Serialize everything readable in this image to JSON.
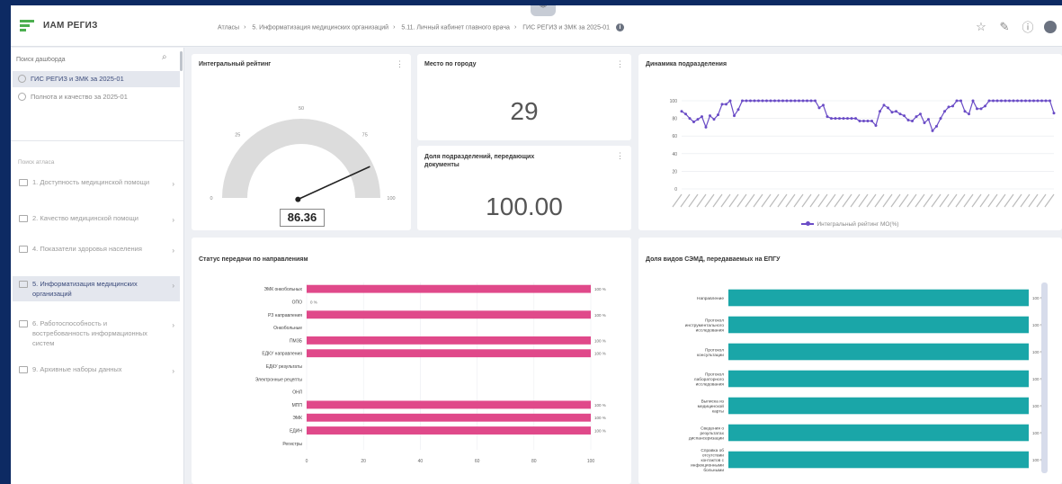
{
  "header": {
    "app_title": "ИАМ РЕГИЗ",
    "breadcrumb": [
      "Атласы",
      "5. Информатизация медицинских организаций",
      "5.11. Личный кабинет главного врача",
      "ГИС РЕГИЗ и ЗМК за 2025-01"
    ],
    "info": "i"
  },
  "sidebar": {
    "search_placeholder": "Поиск дашборда",
    "dashboards": [
      {
        "label": "ГИС РЕГИЗ и ЗМК за 2025-01",
        "active": true
      },
      {
        "label": "Полнота и качество за 2025-01",
        "active": false
      }
    ],
    "atlas_title": "Поиск атласа",
    "atlases": [
      {
        "label": "1. Доступность медицинской помощи",
        "active": false
      },
      {
        "label": "2. Качество медицинской помощи",
        "active": false
      },
      {
        "label": "4. Показатели здоровья населения",
        "active": false
      },
      {
        "label": "5. Информатизация медицинских организаций",
        "active": true
      },
      {
        "label": "6. Работоспособность и востребованность информационных систем",
        "active": false
      },
      {
        "label": "9. Архивные наборы данных",
        "active": false
      }
    ]
  },
  "cards": {
    "gauge": {
      "title": "Интегральный рейтинг",
      "value": "86.36"
    },
    "place": {
      "title": "Место по городу",
      "value": "29"
    },
    "share": {
      "title": "Доля подразделений, передающих документы",
      "value": "100.00"
    },
    "dynamics": {
      "title": "Динамика подразделения",
      "legend": "Интегральный рейтинг МО(%)"
    },
    "status": {
      "title": "Статус передачи по направлениям"
    },
    "semd": {
      "title": "Доля видов СЭМД, передаваемых на ЕПГУ"
    }
  },
  "colors": {
    "pink": "#e0498a",
    "teal": "#1aa6a8",
    "purple": "#6a4cc6",
    "accent_nav": "#3a4a7a"
  },
  "chart_data": [
    {
      "type": "gauge",
      "min": 0,
      "max": 100,
      "ticks": [
        0,
        25,
        50,
        75,
        100
      ],
      "value": 86.36
    },
    {
      "type": "line",
      "title": "Динамика подразделения",
      "ylim": [
        0,
        100
      ],
      "yticks": [
        0,
        20,
        40,
        60,
        80,
        100
      ],
      "series": [
        {
          "name": "Интегральный рейтинг МО(%)",
          "values": [
            88,
            85,
            80,
            76,
            79,
            82,
            70,
            83,
            79,
            84,
            96,
            96,
            100,
            83,
            90,
            100,
            100,
            100,
            100,
            100,
            100,
            100,
            100,
            100,
            100,
            100,
            100,
            100,
            100,
            100,
            100,
            100,
            100,
            100,
            92,
            95,
            82,
            80,
            80,
            80,
            80,
            80,
            80,
            80,
            77,
            77,
            77,
            77,
            72,
            88,
            95,
            92,
            87,
            88,
            85,
            83,
            78,
            77,
            82,
            85,
            75,
            79,
            66,
            71,
            80,
            88,
            93,
            94,
            100,
            100,
            88,
            85,
            100,
            91,
            91,
            94,
            100,
            100,
            100,
            100,
            100,
            100,
            100,
            100,
            100,
            100,
            100,
            100,
            100,
            100,
            100,
            100,
            86
          ]
        }
      ],
      "grid": true
    },
    {
      "type": "bar",
      "orientation": "horizontal",
      "title": "Статус передачи по направлениям",
      "categories": [
        "ЭМК онкобольных",
        "ОПО",
        "РЗ направления",
        "Онкобольные",
        "ПМЗБ",
        "ЕДКУ направления",
        "ЕДКУ результаты",
        "Электронные рецепты",
        "ОНЛ",
        "МПП",
        "ЭМК",
        "ЕДИН",
        "Регистры"
      ],
      "values": [
        100,
        0,
        100,
        0,
        100,
        100,
        0,
        0,
        0,
        100,
        100,
        100,
        0
      ],
      "labels": [
        "100 %",
        "0 %",
        "100 %",
        "",
        "100 %",
        "100 %",
        "",
        "",
        "",
        "100 %",
        "100 %",
        "100 %",
        ""
      ],
      "xlim": [
        0,
        100
      ],
      "xticks": [
        0,
        20,
        40,
        60,
        80,
        100
      ]
    },
    {
      "type": "bar",
      "orientation": "horizontal",
      "title": "Доля видов СЭМД, передаваемых на ЕПГУ",
      "categories": [
        "Направление",
        "Протокол инструментального исследования",
        "Протокол консультации",
        "Протокол лабораторного исследования",
        "Выписка из медицинской карты",
        "Сведения о результатах диспансеризации",
        "Справка об отсутствии контактов с инфекционными больными"
      ],
      "values": [
        100,
        100,
        100,
        100,
        100,
        100,
        100
      ],
      "labels": [
        "100 %",
        "100 %",
        "100 %",
        "100 %",
        "100 %",
        "100 %",
        "100 %"
      ],
      "xlim": [
        0,
        100
      ]
    }
  ]
}
